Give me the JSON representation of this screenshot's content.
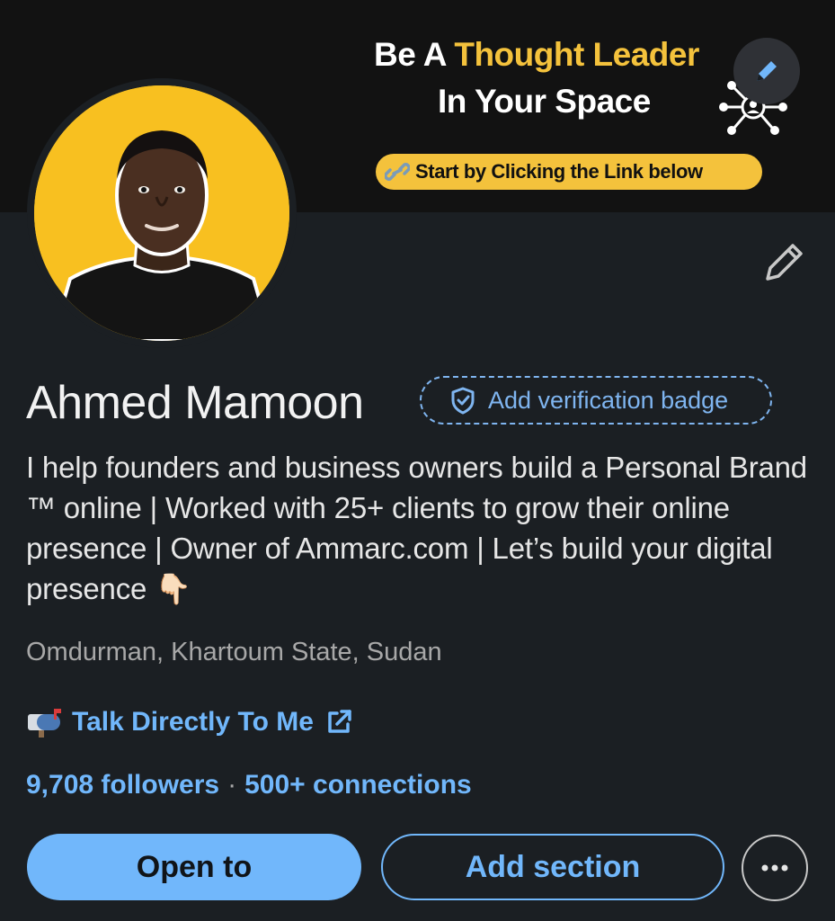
{
  "banner": {
    "line1_prefix": "Be A ",
    "line1_highlight": "Thought Leader",
    "line2": "In Your Space",
    "pill_text": "Start by Clicking the Link below",
    "accent_color": "#f4c23c"
  },
  "icons": {
    "banner_edit": "pencil-icon",
    "profile_edit": "pencil-icon",
    "verification": "shield-check-icon",
    "link_prefix": "mailbox-icon",
    "external_link": "external-link-icon",
    "more": "more-horizontal-icon"
  },
  "profile": {
    "name": "Ahmed Mamoon",
    "verification_label": "Add verification badge",
    "headline": "I help founders and business owners build a Personal Brand ™ online | Worked with 25+ clients to grow their online presence | Owner of Ammarc.com | Let’s build your digital presence 👇🏻",
    "location": "Omdurman, Khartoum State, Sudan",
    "link_label": "Talk Directly To Me",
    "followers": "9,708 followers",
    "separator": "·",
    "connections": "500+ connections"
  },
  "actions": {
    "open_to": "Open to",
    "add_section": "Add section"
  },
  "colors": {
    "background": "#1b1f23",
    "link_blue": "#71b7fb",
    "avatar_bg": "#f8c020"
  }
}
